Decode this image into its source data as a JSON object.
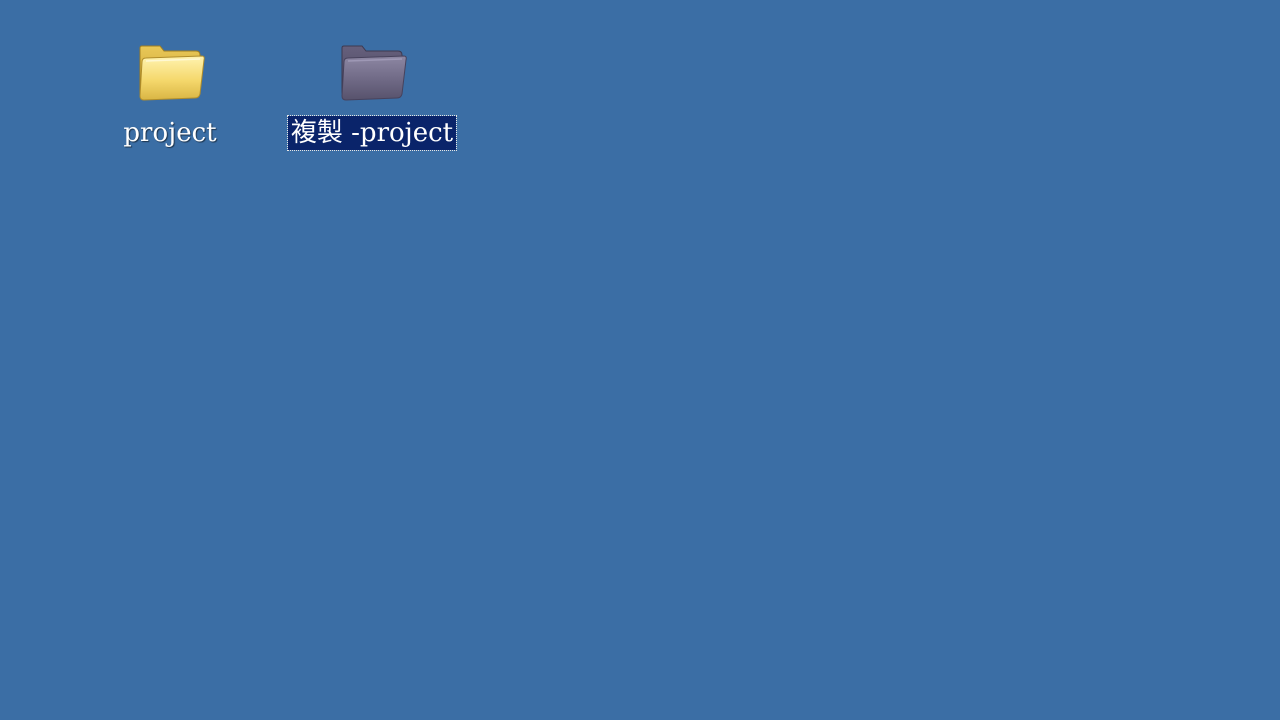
{
  "desktop": {
    "background": "#3b6ea5",
    "icons": [
      {
        "label": "project",
        "icon": "folder-icon",
        "selected": false,
        "color": "#f3d873"
      },
      {
        "label": "複製 -project",
        "icon": "folder-icon",
        "selected": true,
        "color": "#6e6a86",
        "selection_color": "#0a246a"
      }
    ]
  }
}
